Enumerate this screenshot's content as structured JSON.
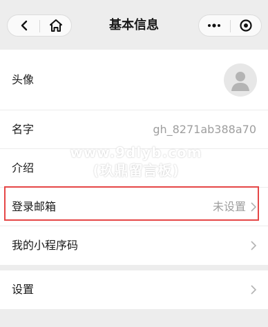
{
  "nav": {
    "title": "基本信息",
    "back_icon": "back-icon",
    "home_icon": "home-icon",
    "more_icon": "more-dots-icon",
    "close_icon": "target-close-icon"
  },
  "rows": {
    "avatar": {
      "label": "头像"
    },
    "name": {
      "label": "名字",
      "value": "gh_8271ab388a70"
    },
    "intro": {
      "label": "介绍"
    },
    "email": {
      "label": "登录邮箱",
      "value": "未设置"
    },
    "qrcode": {
      "label": "我的小程序码"
    },
    "settings": {
      "label": "设置"
    }
  },
  "watermark": {
    "line1": "www.9dlyb.com",
    "line2": "(玖鼎留言板)"
  },
  "colors": {
    "background": "#ededed",
    "highlight": "#e54646",
    "secondary_text": "#9e9e9e"
  }
}
